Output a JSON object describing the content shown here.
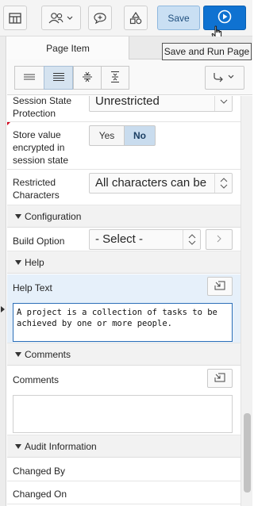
{
  "toolbar": {
    "save_label": "Save",
    "tooltip": "Save and Run Page",
    "icons": [
      "layout-icon",
      "shared-components-icon",
      "comment-icon",
      "shapes-icon",
      "run-icon"
    ]
  },
  "tabs": {
    "active": "Page Item"
  },
  "properties": {
    "session_state_protection": {
      "label": "Session State\nProtection",
      "value": "Unrestricted"
    },
    "store_encrypted": {
      "label": "Store value encrypted in session state",
      "yes": "Yes",
      "no": "No"
    },
    "restricted_characters": {
      "label": "Restricted Characters",
      "value": "All characters can be"
    },
    "configuration": {
      "title": "Configuration"
    },
    "build_option": {
      "label": "Build Option",
      "value": "- Select -"
    },
    "help": {
      "title": "Help"
    },
    "help_text": {
      "label": "Help Text",
      "value": "A project is a collection of tasks to be achieved by one or more people."
    },
    "comments_section": {
      "title": "Comments"
    },
    "comments": {
      "label": "Comments",
      "value": ""
    },
    "audit": {
      "title": "Audit Information"
    },
    "changed_by": {
      "label": "Changed By"
    },
    "changed_on": {
      "label": "Changed On"
    }
  },
  "colors": {
    "accent": "#0f72d1",
    "save_bg": "#c9dff3",
    "selected_row": "#e6f0fa"
  }
}
